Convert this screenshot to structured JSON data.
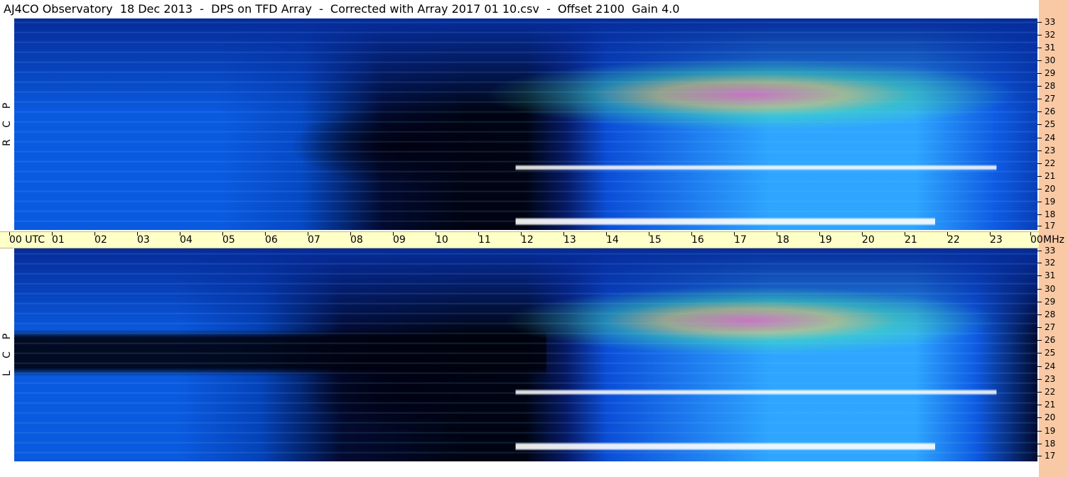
{
  "window": {
    "title": "AJ4CO Observatory  18 Dec 2013  -  DPS on TFD Array  -  Corrected with Array 2017 01 10.csv  -  Offset 2100  Gain 4.0"
  },
  "panes": [
    {
      "id": "rcp",
      "label_letters": [
        "P",
        "C",
        "R"
      ]
    },
    {
      "id": "lcp",
      "label_letters": [
        "P",
        "C",
        "L"
      ]
    }
  ],
  "frequency_axis": {
    "ticks": [
      "33",
      "32",
      "31",
      "30",
      "29",
      "28",
      "27",
      "26",
      "25",
      "24",
      "23",
      "22",
      "21",
      "20",
      "19",
      "18",
      "17"
    ]
  },
  "time_axis": {
    "ticks": [
      "00",
      "01",
      "02",
      "03",
      "04",
      "05",
      "06",
      "07",
      "08",
      "09",
      "10",
      "11",
      "12",
      "13",
      "14",
      "15",
      "16",
      "17",
      "18",
      "19",
      "20",
      "21",
      "22",
      "23",
      "00"
    ],
    "utc_label": "UTC",
    "unit_label": "MHz"
  },
  "colors": {
    "background": "#0a4bd0",
    "night": "#020822",
    "axis_strip": "#f8c9a4",
    "time_strip": "#ffffc8"
  }
}
